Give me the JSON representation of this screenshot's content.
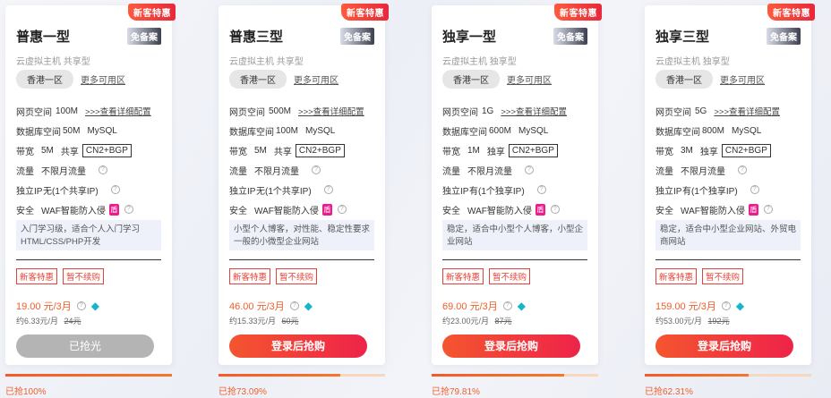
{
  "cards": [
    {
      "ribbon": "新客特惠",
      "title": "普惠一型",
      "badge": "免备案",
      "subtitle": "云虚拟主机 共享型",
      "region": "香港一区",
      "more_regions": "更多可用区",
      "specs": {
        "web_label": "网页空间",
        "web_value": "100M",
        "web_link": ">>>查看详细配置",
        "db_label": "数据库空间",
        "db_value": "50M",
        "db_type": "MySQL",
        "bw_label": "带宽",
        "bw_value": "5M",
        "bw_type": "共享",
        "bw_line": "CN2+BGP",
        "traffic_label": "流量",
        "traffic_value": "不限月流量",
        "ip_label": "独立IP",
        "ip_value": "无(1个共享IP)",
        "sec_label": "安全",
        "sec_value": "WAF智能防入侵",
        "sec_icon_text": "盾"
      },
      "desc": "入门学习级，适合个人入门学习HTML/CSS/PHP开发",
      "promos": [
        "新客特惠",
        "暂不续购"
      ],
      "price": "19.00 元/3月",
      "monthly": "约6.33元/月",
      "original": "24元",
      "button": "已抢光",
      "sold_out": true,
      "progress": 100,
      "progress_text": "已抢100%"
    },
    {
      "ribbon": "新客特惠",
      "title": "普惠三型",
      "badge": "免备案",
      "subtitle": "云虚拟主机 共享型",
      "region": "香港一区",
      "more_regions": "更多可用区",
      "specs": {
        "web_label": "网页空间",
        "web_value": "500M",
        "web_link": ">>>查看详细配置",
        "db_label": "数据库空间",
        "db_value": "100M",
        "db_type": "MySQL",
        "bw_label": "带宽",
        "bw_value": "5M",
        "bw_type": "共享",
        "bw_line": "CN2+BGP",
        "traffic_label": "流量",
        "traffic_value": "不限月流量",
        "ip_label": "独立IP",
        "ip_value": "无(1个共享IP)",
        "sec_label": "安全",
        "sec_value": "WAF智能防入侵",
        "sec_icon_text": "盾"
      },
      "desc": "小型个人博客，对性能、稳定性要求一般的小微型企业网站",
      "promos": [
        "新客特惠",
        "暂不续购"
      ],
      "price": "46.00 元/3月",
      "monthly": "约15.33元/月",
      "original": "60元",
      "button": "登录后抢购",
      "sold_out": false,
      "progress": 73.09,
      "progress_text": "已抢73.09%"
    },
    {
      "ribbon": "新客特惠",
      "title": "独享一型",
      "badge": "免备案",
      "subtitle": "云虚拟主机 独享型",
      "region": "香港一区",
      "more_regions": "更多可用区",
      "specs": {
        "web_label": "网页空间",
        "web_value": "1G",
        "web_link": ">>>查看详细配置",
        "db_label": "数据库空间",
        "db_value": "600M",
        "db_type": "MySQL",
        "bw_label": "带宽",
        "bw_value": "1M",
        "bw_type": "独享",
        "bw_line": "CN2+BGP",
        "traffic_label": "流量",
        "traffic_value": "不限月流量",
        "ip_label": "独立IP",
        "ip_value": "有(1个独享IP)",
        "sec_label": "安全",
        "sec_value": "WAF智能防入侵",
        "sec_icon_text": "盾"
      },
      "desc": "稳定，适合中小型个人博客，小型企业网站",
      "promos": [
        "新客特惠",
        "暂不续购"
      ],
      "price": "69.00 元/3月",
      "monthly": "约23.00元/月",
      "original": "87元",
      "button": "登录后抢购",
      "sold_out": false,
      "progress": 79.81,
      "progress_text": "已抢79.81%"
    },
    {
      "ribbon": "新客特惠",
      "title": "独享三型",
      "badge": "免备案",
      "subtitle": "云虚拟主机 独享型",
      "region": "香港一区",
      "more_regions": "更多可用区",
      "specs": {
        "web_label": "网页空间",
        "web_value": "5G",
        "web_link": ">>>查看详细配置",
        "db_label": "数据库空间",
        "db_value": "800M",
        "db_type": "MySQL",
        "bw_label": "带宽",
        "bw_value": "3M",
        "bw_type": "独享",
        "bw_line": "CN2+BGP",
        "traffic_label": "流量",
        "traffic_value": "不限月流量",
        "ip_label": "独立IP",
        "ip_value": "有(1个独享IP)",
        "sec_label": "安全",
        "sec_value": "WAF智能防入侵",
        "sec_icon_text": "盾"
      },
      "desc": "稳定，适合中小型企业网站、外贸电商网站",
      "promos": [
        "新客特惠",
        "暂不续购"
      ],
      "price": "159.00 元/3月",
      "monthly": "约53.00元/月",
      "original": "192元",
      "button": "登录后抢购",
      "sold_out": false,
      "progress": 62.31,
      "progress_text": "已抢62.31%"
    }
  ]
}
